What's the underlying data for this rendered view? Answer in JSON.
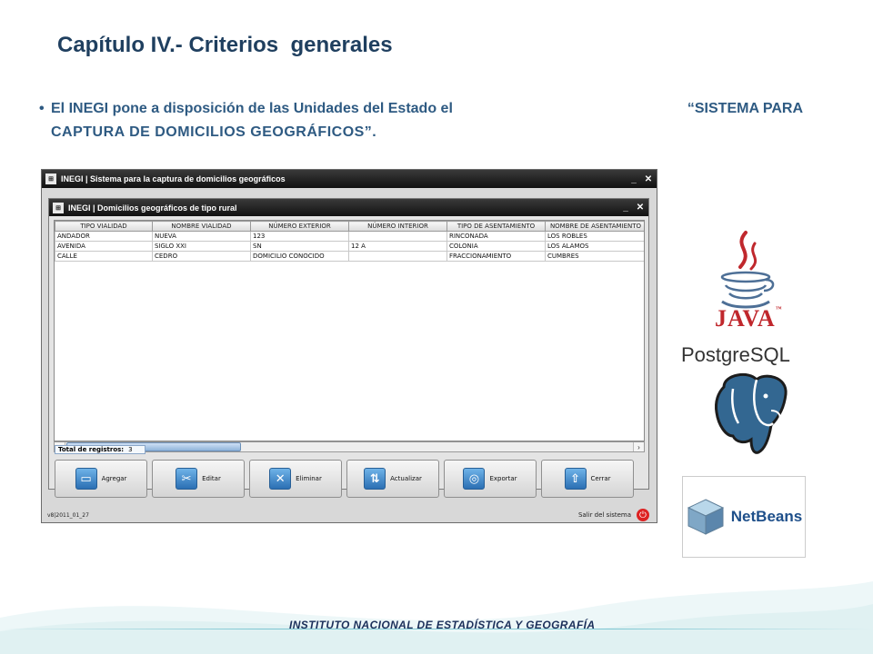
{
  "slide": {
    "title": "Capítulo IV.- Criterios  generales",
    "bullet_line1_part1": "El INEGI pone a disposición de las Unidades del Estado el",
    "bullet_line1_part2": "“SISTEMA PARA",
    "bullet_line2": "CAPTURA DE DOMICILIOS GEOGRÁFICOS”.",
    "footer": "INSTITUTO NACIONAL  DE ESTADÍSTICA Y GEOGRAFÍA"
  },
  "app": {
    "title": "INEGI | Sistema para la captura de domicilios geográficos",
    "inner_title": "INEGI | Domicilios geográficos de tipo rural",
    "columns": [
      "TIPO VIALIDAD",
      "NOMBRE VIALIDAD",
      "NÚMERO EXTERIOR",
      "NÚMERO INTERIOR",
      "TIPO DE ASENTAMIENTO",
      "NOMBRE DE ASENTAMIENTO"
    ],
    "rows": [
      [
        "ANDADOR",
        "NUEVA",
        "123",
        "",
        "RINCONADA",
        "LOS ROBLES"
      ],
      [
        "AVENIDA",
        "SIGLO XXI",
        "SN",
        "12 A",
        "COLONIA",
        "LOS ALAMOS"
      ],
      [
        "CALLE",
        "CEDRO",
        "DOMICILIO CONOCIDO",
        "",
        "FRACCIONAMIENTO",
        "CUMBRES"
      ]
    ],
    "total_label": "Total de registros:",
    "total_value": "3",
    "buttons": {
      "add": "Agregar",
      "edit": "Editar",
      "delete": "Eliminar",
      "update": "Actualizar",
      "export": "Exportar",
      "close": "Cerrar"
    },
    "version": "v8|2011_01_27",
    "exit_label": "Salir del sistema"
  },
  "logos": {
    "java_word": "JAVA",
    "postgres_word": "PostgreSQL",
    "netbeans_word": "NetBeans"
  },
  "colors": {
    "title": "#1f3f5f",
    "bullet": "#2e5a82",
    "java_red": "#c0282d",
    "postgres_blue": "#336791",
    "footer": "#1b2f5a"
  }
}
